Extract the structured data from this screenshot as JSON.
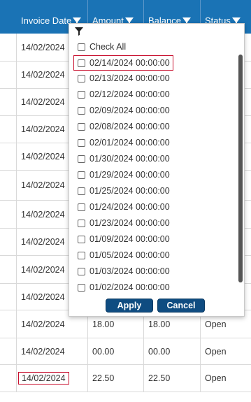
{
  "grid": {
    "headers": [
      {
        "label": "Invoice Date",
        "filter_icon": "funnel-icon"
      },
      {
        "label": "Amount",
        "filter_icon": "funnel-icon"
      },
      {
        "label": "Balance",
        "filter_icon": "funnel-icon"
      },
      {
        "label": "Status",
        "filter_icon": "funnel-icon"
      }
    ],
    "rows": [
      {
        "invoice_date": "14/02/2024",
        "amount": "",
        "balance": "",
        "status": ""
      },
      {
        "invoice_date": "14/02/2024",
        "amount": "",
        "balance": "",
        "status": ""
      },
      {
        "invoice_date": "14/02/2024",
        "amount": "",
        "balance": "",
        "status": ""
      },
      {
        "invoice_date": "14/02/2024",
        "amount": "",
        "balance": "",
        "status": ""
      },
      {
        "invoice_date": "14/02/2024",
        "amount": "",
        "balance": "",
        "status": ""
      },
      {
        "invoice_date": "14/02/2024",
        "amount": "",
        "balance": "",
        "status": ""
      },
      {
        "invoice_date": "14/02/2024",
        "amount": "",
        "balance": "",
        "status": ""
      },
      {
        "invoice_date": "14/02/2024",
        "amount": "",
        "balance": "",
        "status": ""
      },
      {
        "invoice_date": "14/02/2024",
        "amount": "",
        "balance": "",
        "status": ""
      },
      {
        "invoice_date": "14/02/2024",
        "amount": "",
        "balance": "",
        "status": ""
      },
      {
        "invoice_date": "14/02/2024",
        "amount": "18.00",
        "balance": "18.00",
        "status": "Open"
      },
      {
        "invoice_date": "14/02/2024",
        "amount": "00.00",
        "balance": "00.00",
        "status": "Open"
      },
      {
        "invoice_date": "14/02/2024",
        "amount": "22.50",
        "balance": "22.50",
        "status": "Open"
      }
    ]
  },
  "filter_popup": {
    "icon": "funnel-icon",
    "check_all_label": "Check All",
    "options": [
      "02/14/2024 00:00:00",
      "02/13/2024 00:00:00",
      "02/12/2024 00:00:00",
      "02/09/2024 00:00:00",
      "02/08/2024 00:00:00",
      "02/01/2024 00:00:00",
      "01/30/2024 00:00:00",
      "01/29/2024 00:00:00",
      "01/25/2024 00:00:00",
      "01/24/2024 00:00:00",
      "01/23/2024 00:00:00",
      "01/09/2024 00:00:00",
      "01/05/2024 00:00:00",
      "01/03/2024 00:00:00",
      "01/02/2024 00:00:00"
    ],
    "apply_label": "Apply",
    "cancel_label": "Cancel"
  },
  "colors": {
    "header_bg": "#1a73b5",
    "button_bg": "#0f4c81",
    "highlight_border": "#c8102e"
  }
}
